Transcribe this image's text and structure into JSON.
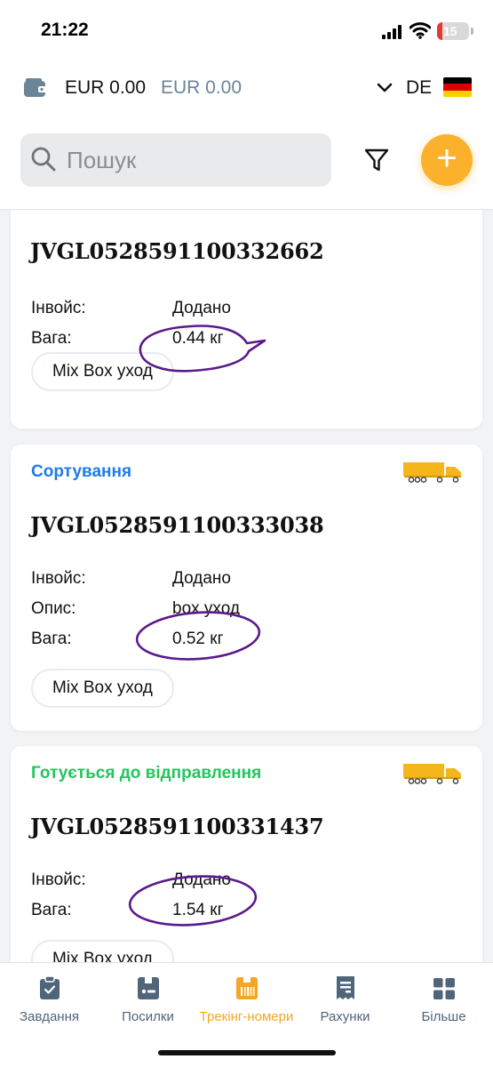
{
  "status_bar": {
    "time": "21:22",
    "battery": "15"
  },
  "header": {
    "balance_main": "EUR 0.00",
    "balance_secondary": "EUR 0.00",
    "language": "DE",
    "search": {
      "placeholder": "Пошук"
    },
    "add_label": "+"
  },
  "colors": {
    "accent": "#fbb12b",
    "status_sorting": "#1e7ce6",
    "status_preparing": "#22c55e",
    "annotation": "#5b1a8c"
  },
  "cards": [
    {
      "status": "",
      "tracking": "JVGL0528591100332662",
      "rows": [
        {
          "label": "Інвойс:",
          "value": "Додано"
        },
        {
          "label": "Вага:",
          "value": "0.44 кг"
        }
      ],
      "tag": "Mix Box уход"
    },
    {
      "status": "Сортування",
      "tracking": "JVGL0528591100333038",
      "rows": [
        {
          "label": "Інвойс:",
          "value": "Додано"
        },
        {
          "label": "Опис:",
          "value": "box уход"
        },
        {
          "label": "Вага:",
          "value": "0.52 кг"
        }
      ],
      "tag": "Mix Box уход"
    },
    {
      "status": "Готується до відправлення",
      "tracking": "JVGL0528591100331437",
      "rows": [
        {
          "label": "Інвойс:",
          "value": "Додано"
        },
        {
          "label": "Вага:",
          "value": "1.54 кг"
        }
      ],
      "tag": "Mix Box уход"
    }
  ],
  "tabs": [
    {
      "label": "Завдання",
      "icon": "clipboard-icon"
    },
    {
      "label": "Посилки",
      "icon": "parcel-icon"
    },
    {
      "label": "Трекінг-номери",
      "icon": "barcode-icon",
      "active": true
    },
    {
      "label": "Рахунки",
      "icon": "receipt-icon"
    },
    {
      "label": "Більше",
      "icon": "grid-icon"
    }
  ]
}
